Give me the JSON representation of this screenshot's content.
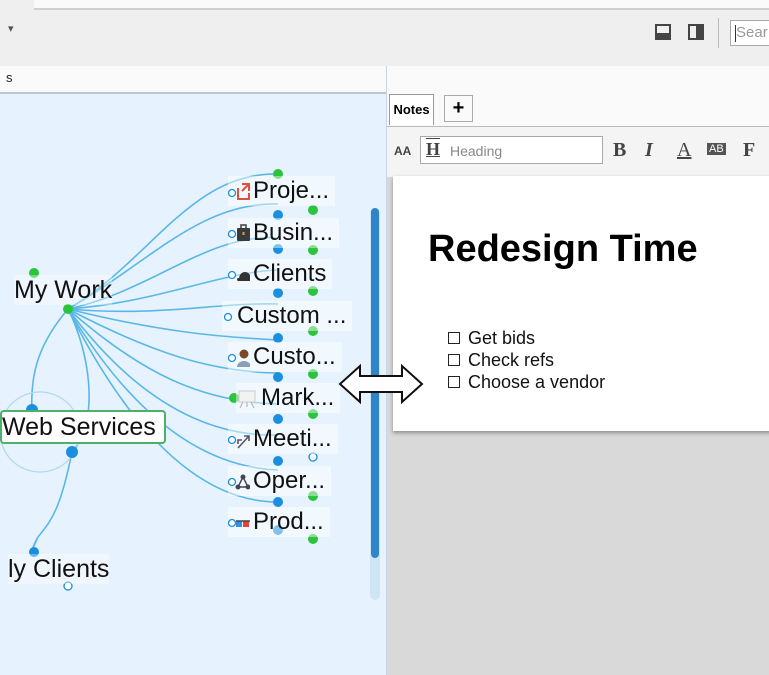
{
  "toolbar": {
    "dropdown_glyph": "▾",
    "search_placeholder": "Sear",
    "icons": [
      "bottom-pane-icon",
      "side-pane-icon"
    ]
  },
  "left_panel": {
    "tab_fragment": "s"
  },
  "map": {
    "central": "My Work",
    "main_topic": "Web Services",
    "sub_topic": "ly Clients",
    "children": [
      {
        "label": "Proje...",
        "icon": "project-arrow-icon"
      },
      {
        "label": "Busin...",
        "icon": "briefcase-icon"
      },
      {
        "label": "Clients",
        "icon": "bowler-hat-icon"
      },
      {
        "label": "Custom ...",
        "icon": ""
      },
      {
        "label": "Custo...",
        "icon": "person-icon"
      },
      {
        "label": "Mark...",
        "icon": "presentation-icon"
      },
      {
        "label": "Meeti...",
        "icon": "arrows-icon"
      },
      {
        "label": "Oper...",
        "icon": "network-icon"
      },
      {
        "label": "Prod...",
        "icon": "3d-glasses-icon"
      }
    ],
    "colors": {
      "link": "#5ab8e6",
      "dot_green": "#2bc43c",
      "dot_blue": "#1a8fe0",
      "border_green": "#4ab06a"
    }
  },
  "notes": {
    "tab_label": "Notes",
    "add_tab": "+",
    "font_size_icon": "AA",
    "style_placeholder": "Heading",
    "format": {
      "bold": "B",
      "italic": "I",
      "color": "A",
      "highlight": "AB",
      "font": "F"
    },
    "title": "Redesign Time",
    "items": [
      "Get bids",
      "Check refs",
      "Choose a vendor"
    ]
  }
}
